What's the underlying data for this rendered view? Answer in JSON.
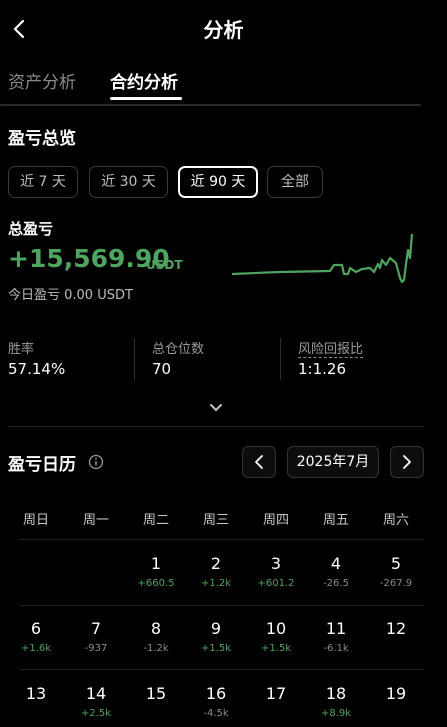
{
  "header": {
    "title": "分析"
  },
  "tabs": [
    {
      "label": "资产分析",
      "active": false
    },
    {
      "label": "合约分析",
      "active": true
    }
  ],
  "overview": {
    "title": "盈亏总览",
    "ranges": [
      "近 7 天",
      "近 30 天",
      "近 90 天",
      "全部"
    ],
    "selected_range": "近 90 天"
  },
  "pnl": {
    "label": "总盈亏",
    "value": "+15,569.90",
    "unit": "USDT",
    "today": "今日盈亏  0.00 USDT",
    "sparkline_color": "#4ea55f"
  },
  "stats": [
    {
      "label": "胜率",
      "value": "57.14%"
    },
    {
      "label": "总仓位数",
      "value": "70"
    },
    {
      "label": "风险回报比",
      "value": "1:1.26"
    }
  ],
  "calendar": {
    "title": "盈亏日历",
    "month": "2025年7月",
    "weekdays": [
      "周日",
      "周一",
      "周二",
      "周三",
      "周四",
      "周五",
      "周六"
    ],
    "rows": [
      [
        null,
        null,
        {
          "day": "1",
          "pnl": "+660.5",
          "positive": true
        },
        {
          "day": "2",
          "pnl": "+1.2k",
          "positive": true
        },
        {
          "day": "3",
          "pnl": "+601.2",
          "positive": true
        },
        {
          "day": "4",
          "pnl": "-26.5",
          "positive": false
        },
        {
          "day": "5",
          "pnl": "-267.9",
          "positive": false
        }
      ],
      [
        {
          "day": "6",
          "pnl": "+1.6k",
          "positive": true
        },
        {
          "day": "7",
          "pnl": "-937",
          "positive": false
        },
        {
          "day": "8",
          "pnl": "-1.2k",
          "positive": false
        },
        {
          "day": "9",
          "pnl": "+1.5k",
          "positive": true
        },
        {
          "day": "10",
          "pnl": "+1.5k",
          "positive": true
        },
        {
          "day": "11",
          "pnl": "-6.1k",
          "positive": false
        },
        {
          "day": "12",
          "pnl": "",
          "positive": true
        }
      ],
      [
        {
          "day": "13",
          "pnl": "",
          "positive": true
        },
        {
          "day": "14",
          "pnl": "+2.5k",
          "positive": true
        },
        {
          "day": "15",
          "pnl": "",
          "positive": true
        },
        {
          "day": "16",
          "pnl": "-4.5k",
          "positive": false
        },
        {
          "day": "17",
          "pnl": "",
          "positive": true
        },
        {
          "day": "18",
          "pnl": "+8.9k",
          "positive": true
        },
        {
          "day": "19",
          "pnl": "",
          "positive": true
        }
      ]
    ]
  },
  "colors": {
    "positive": "#4ea55f",
    "negative": "#8a8a8a",
    "background": "#000000"
  },
  "icons": {
    "back": "chevron-left-icon",
    "expand": "chevron-down-icon",
    "info": "info-icon",
    "prev": "chevron-left-icon",
    "next": "chevron-right-icon"
  }
}
